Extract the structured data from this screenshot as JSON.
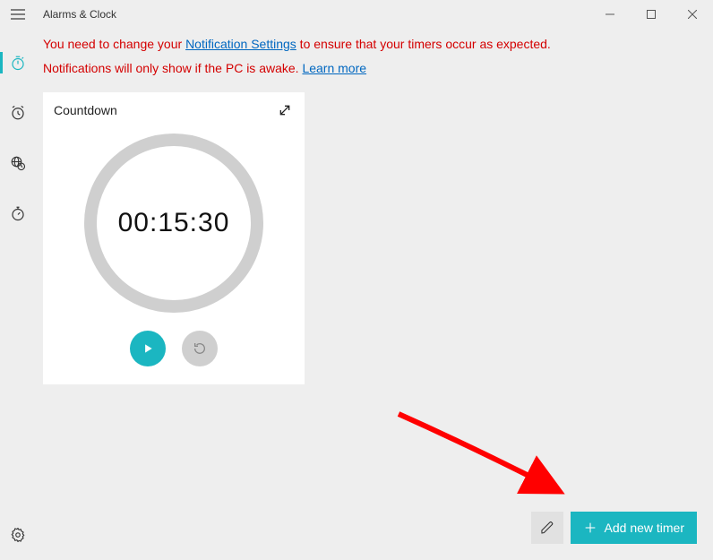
{
  "app": {
    "title": "Alarms & Clock"
  },
  "notice": {
    "part1": "You need to change your ",
    "link1": "Notification Settings",
    "part2": " to ensure that your timers occur as expected.",
    "part3": "Notifications will only show if the PC is awake. ",
    "link2": "Learn more"
  },
  "timer_card": {
    "title": "Countdown",
    "time": "00:15:30"
  },
  "bottom": {
    "add_label": "Add new timer"
  },
  "colors": {
    "accent": "#1bb6c1",
    "danger": "#d40000"
  }
}
